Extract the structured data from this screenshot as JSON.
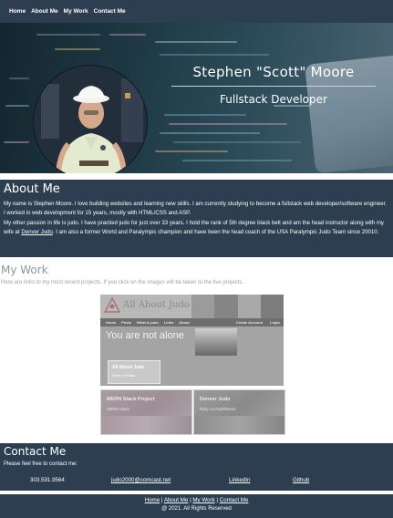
{
  "nav": {
    "items": [
      "Home",
      "About Me",
      "My Work",
      "Contact Me"
    ]
  },
  "hero": {
    "name": "Stephen \"Scott\" Moore",
    "title": "Fullstack Developer"
  },
  "about": {
    "heading": "About Me",
    "para1": "My name is Stephen Moore. I love building websites and learning new skills. I am currently studying to become a fullstack web developer/software engineer. I worked in web development for 15 years, mostly with HTML/CSS and ASP.",
    "para2_start": "My other passion in life is judo. I have practied judo for just over 33 years. I hold the rank of 5th degree black belt and am the head instructor along with my wife at ",
    "para2_link": "Denver Judo",
    "para2_end": ". I am also a former World and Paralympic champion and have been the head coach of the USA Paralympic Judo Team since 20010."
  },
  "work": {
    "heading": "My Work",
    "intro": "Here are links to my most recent projects. If you click on the images will be taken to the live projects.",
    "main_project": {
      "brand": "All About Judo",
      "menu_left": [
        "Home",
        "Posts",
        "What is judo",
        "Links",
        "About"
      ],
      "menu_right": [
        "Create Account",
        "Login"
      ],
      "headline": "You are not alone",
      "card_title": "All About Judo",
      "card_sub": "Ruby on Rails"
    },
    "project_two": {
      "title": "MERN Stack Project",
      "sub": "MERN Stack"
    },
    "project_three": {
      "title": "Denver Judo",
      "sub": "Ruby on Rails/React"
    }
  },
  "contact": {
    "heading": "Contact Me",
    "prompt": "Please feel free to contact me:",
    "phone": "303.591.9564",
    "email": "judo2000@comcast.net",
    "linkedin": "LinkedIn",
    "github": "Github"
  },
  "footer": {
    "links": [
      "Home",
      "About Me",
      "My Work",
      "Contact Me"
    ],
    "copyright": "@ 2021. All Rights Reserved"
  },
  "colors": {
    "primary": "#2c3e50",
    "text_light": "#ffffff",
    "muted": "#8d969c"
  }
}
